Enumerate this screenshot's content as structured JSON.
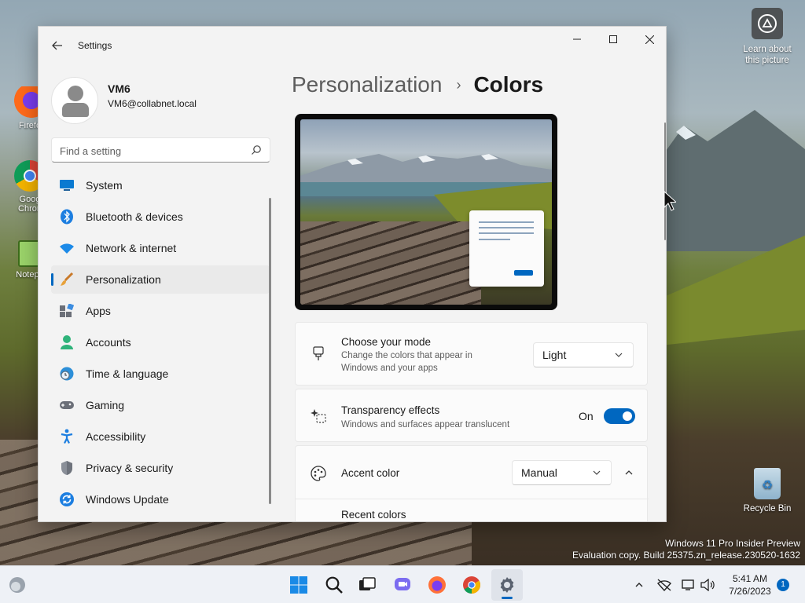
{
  "desktop": {
    "icons": [
      {
        "label": "Firefo"
      },
      {
        "label": "Goog\nChron"
      },
      {
        "label": "Notepa"
      }
    ],
    "learn_about": "Learn about this picture",
    "recycle_bin": "Recycle Bin",
    "watermark": {
      "line1": "Windows 11 Pro Insider Preview",
      "line2": "Evaluation copy. Build 25375.zn_release.230520-1632"
    }
  },
  "window": {
    "title": "Settings",
    "profile": {
      "name": "VM6",
      "email": "VM6@collabnet.local"
    },
    "search": {
      "placeholder": "Find a setting"
    },
    "nav": [
      {
        "label": "System",
        "icon": "monitor-icon",
        "active": false
      },
      {
        "label": "Bluetooth & devices",
        "icon": "bluetooth-icon",
        "active": false
      },
      {
        "label": "Network & internet",
        "icon": "wifi-icon",
        "active": false
      },
      {
        "label": "Personalization",
        "icon": "paintbrush-icon",
        "active": true
      },
      {
        "label": "Apps",
        "icon": "apps-icon",
        "active": false
      },
      {
        "label": "Accounts",
        "icon": "person-icon",
        "active": false
      },
      {
        "label": "Time & language",
        "icon": "clock-globe-icon",
        "active": false
      },
      {
        "label": "Gaming",
        "icon": "gamepad-icon",
        "active": false
      },
      {
        "label": "Accessibility",
        "icon": "accessibility-icon",
        "active": false
      },
      {
        "label": "Privacy & security",
        "icon": "shield-icon",
        "active": false
      },
      {
        "label": "Windows Update",
        "icon": "update-icon",
        "active": false
      }
    ],
    "breadcrumb": {
      "parent": "Personalization",
      "separator": "›",
      "current": "Colors"
    },
    "mode_card": {
      "title": "Choose your mode",
      "description": "Change the colors that appear in Windows and your apps",
      "value": "Light"
    },
    "transparency_card": {
      "title": "Transparency effects",
      "description": "Windows and surfaces appear translucent",
      "state_label": "On",
      "enabled": true
    },
    "accent_card": {
      "title": "Accent color",
      "value": "Manual",
      "expanded": true,
      "recent_colors_label": "Recent colors"
    }
  },
  "taskbar": {
    "clock": {
      "time": "5:41 AM",
      "date": "7/26/2023"
    },
    "notification_count": "1"
  },
  "colors": {
    "accent": "#0067c0"
  }
}
